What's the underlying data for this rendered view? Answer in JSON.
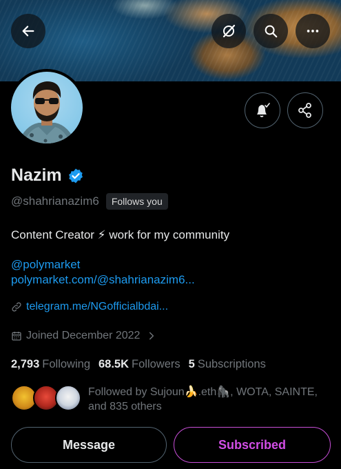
{
  "colors": {
    "background": "#000000",
    "link": "#1d9bf0",
    "muted": "#71767b",
    "subscribe_accent": "#d24ee6",
    "verified": "#1d9bf0"
  },
  "header": {
    "back_icon": "arrow-left-icon",
    "buttons": [
      "no-edit-icon",
      "search-icon",
      "more-icon"
    ]
  },
  "profile": {
    "name": "Nazim",
    "handle": "@shahrianazim6",
    "follows_badge": "Follows you",
    "bio": "Content Creator ⚡ work for my community",
    "bio_links": [
      "@polymarket",
      "polymarket.com/@shahrianazim6..."
    ],
    "website": "telegram.me/NGofficialbdai...",
    "joined": "Joined December 2022"
  },
  "stats": [
    {
      "value": "2,793",
      "label": "Following"
    },
    {
      "value": "68.5K",
      "label": "Followers"
    },
    {
      "value": "5",
      "label": "Subscriptions"
    }
  ],
  "followed_by": {
    "line1": "Followed by Sujoun🍌.eth🦍, WOTA, SAINTE,",
    "line2": "and 835 others"
  },
  "actions": {
    "message_label": "Message",
    "subscribed_label": "Subscribed"
  }
}
